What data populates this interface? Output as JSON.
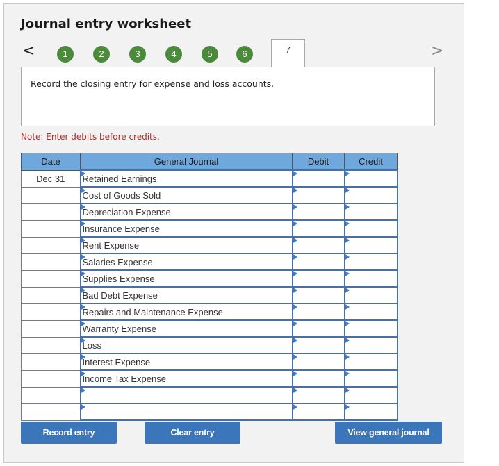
{
  "title": "Journal entry worksheet",
  "nav": {
    "prev_icon": "chevron-left-icon",
    "next_icon": "chevron-right-icon",
    "prev_glyph": "<",
    "next_glyph": ">",
    "steps": [
      "1",
      "2",
      "3",
      "4",
      "5",
      "6"
    ],
    "active_step": "7"
  },
  "prompt": "Record the closing entry for expense and loss accounts.",
  "note": "Note: Enter debits before credits.",
  "table": {
    "headers": {
      "date": "Date",
      "account": "General Journal",
      "debit": "Debit",
      "credit": "Credit"
    },
    "rows": [
      {
        "date": "Dec 31",
        "account": "Retained Earnings",
        "debit": "",
        "credit": ""
      },
      {
        "date": "",
        "account": "Cost of Goods Sold",
        "debit": "",
        "credit": ""
      },
      {
        "date": "",
        "account": "Depreciation Expense",
        "debit": "",
        "credit": ""
      },
      {
        "date": "",
        "account": "Insurance Expense",
        "debit": "",
        "credit": ""
      },
      {
        "date": "",
        "account": "Rent Expense",
        "debit": "",
        "credit": ""
      },
      {
        "date": "",
        "account": "Salaries Expense",
        "debit": "",
        "credit": ""
      },
      {
        "date": "",
        "account": "Supplies Expense",
        "debit": "",
        "credit": ""
      },
      {
        "date": "",
        "account": "Bad Debt Expense",
        "debit": "",
        "credit": ""
      },
      {
        "date": "",
        "account": "Repairs and Maintenance Expense",
        "debit": "",
        "credit": ""
      },
      {
        "date": "",
        "account": "Warranty Expense",
        "debit": "",
        "credit": ""
      },
      {
        "date": "",
        "account": "Loss",
        "debit": "",
        "credit": ""
      },
      {
        "date": "",
        "account": "Interest Expense",
        "debit": "",
        "credit": ""
      },
      {
        "date": "",
        "account": "Income Tax Expense",
        "debit": "",
        "credit": ""
      },
      {
        "date": "",
        "account": "",
        "debit": "",
        "credit": ""
      },
      {
        "date": "",
        "account": "",
        "debit": "",
        "credit": ""
      }
    ]
  },
  "buttons": {
    "record": "Record entry",
    "clear": "Clear entry",
    "view": "View general journal"
  },
  "colors": {
    "step_green": "#4a8a3a",
    "header_blue": "#6fa8dc",
    "input_border": "#4a6fa5",
    "button_blue": "#3b76bb",
    "note_red": "#b52a2a"
  }
}
